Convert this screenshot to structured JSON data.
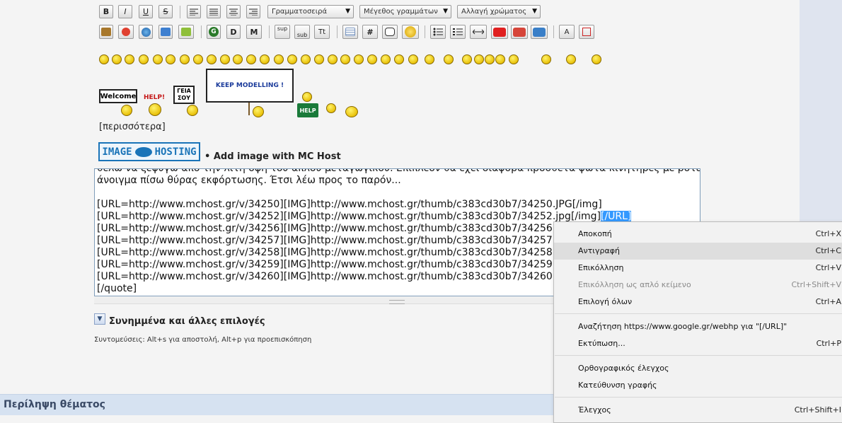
{
  "toolbar": {
    "row1": {
      "bold": "B",
      "italic": "I",
      "underline": "U",
      "strike": "S",
      "font_select": "Γραμματοσειρά",
      "size_select": "Μέγεθος γραμμάτων",
      "color_select": "Αλλαγή χρώματος"
    },
    "row2": {
      "g_label": "G",
      "d_label": "D",
      "m_label": "M",
      "sup": "sup",
      "sub": "sub",
      "tt": "Tt",
      "hash": "#"
    }
  },
  "signs": {
    "welcome": "Welcome",
    "help1": "HELP!",
    "geia_line1": "ΓΕΙΑ",
    "geia_line2": "ΣΟΥ",
    "keep": "KEEP MODELLING !",
    "help2": "HELP"
  },
  "more_link": "[περισσότερα]",
  "mchost": {
    "logo_left": "IMAGE",
    "logo_right": "HOSTING",
    "add_label": "• Add image with MC Host"
  },
  "editor": {
    "line0": "θέλω να ξεφύγω από την λιτή όψη του απλού μεταγωγικού. Επιπλέον θα έχει διάφορα πρόσθετα φώτα κινητήρες με ρότερ",
    "line1": "άνοιγμα πίσω θύρας εκφόρτωσης. Έτσι λέω προς το παρόν...",
    "line3": "[URL=http://www.mchost.gr/v/34250][IMG]http://www.mchost.gr/thumb/c383cd30b7/34250.JPG[/img]",
    "line4": "[URL=http://www.mchost.gr/v/34252][IMG]http://www.mchost.gr/thumb/c383cd30b7/34252.jpg[/img]",
    "line4_selected": "[/URL]",
    "line5": "[URL=http://www.mchost.gr/v/34256][IMG]http://www.mchost.gr/thumb/c383cd30b7/34256",
    "line6": "[URL=http://www.mchost.gr/v/34257][IMG]http://www.mchost.gr/thumb/c383cd30b7/34257",
    "line7": "[URL=http://www.mchost.gr/v/34258][IMG]http://www.mchost.gr/thumb/c383cd30b7/34258",
    "line8": "[URL=http://www.mchost.gr/v/34259][IMG]http://www.mchost.gr/thumb/c383cd30b7/34259",
    "line9": "[URL=http://www.mchost.gr/v/34260][IMG]http://www.mchost.gr/thumb/c383cd30b7/34260",
    "line10": "[/quote]"
  },
  "attachments_label": "Συνημμένα και άλλες επιλογές",
  "shortcuts_text": "Συντομεύσεις: Alt+s για αποστολή, Alt+p για προεπισκόπηση",
  "summary_title": "Περίληψη θέματος",
  "context_menu": {
    "cut": {
      "label": "Αποκοπή",
      "shortcut": "Ctrl+X"
    },
    "copy": {
      "label": "Αντιγραφή",
      "shortcut": "Ctrl+C"
    },
    "paste": {
      "label": "Επικόλληση",
      "shortcut": "Ctrl+V"
    },
    "paste_plain": {
      "label": "Επικόλληση ως απλό κείμενο",
      "shortcut": "Ctrl+Shift+V"
    },
    "select_all": {
      "label": "Επιλογή όλων",
      "shortcut": "Ctrl+A"
    },
    "search": {
      "label": "Αναζήτηση https://www.google.gr/webhp για \"[/URL]\""
    },
    "print": {
      "label": "Εκτύπωση...",
      "shortcut": "Ctrl+P"
    },
    "spell": {
      "label": "Ορθογραφικός έλεγχος"
    },
    "direction": {
      "label": "Κατεύθυνση γραφής"
    },
    "inspect": {
      "label": "Έλεγχος",
      "shortcut": "Ctrl+Shift+I"
    }
  }
}
